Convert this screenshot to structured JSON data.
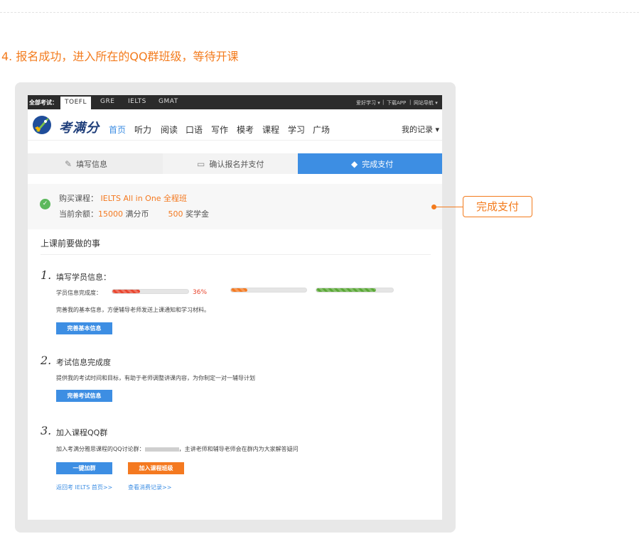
{
  "step_heading": "4. 报名成功，进入所在的QQ群班级，等待开课",
  "exam_bar": {
    "label": "全部考试：",
    "tabs": [
      "TOEFL",
      "GRE",
      "IELTS",
      "GMAT"
    ],
    "active_tab": "TOEFL",
    "right": [
      "爱好学习 ▾",
      "|",
      "下载APP",
      "|",
      "网站导航 ▾"
    ]
  },
  "nav": {
    "brand": "考满分",
    "items": [
      "首页",
      "听力",
      "阅读",
      "口语",
      "写作",
      "模考",
      "课程",
      "学习",
      "广场"
    ],
    "active_item": "首页",
    "my_record": "我的记录 ▾"
  },
  "stepper": {
    "steps": [
      "填写信息",
      "确认报名并支付",
      "完成支付"
    ],
    "current": "完成支付"
  },
  "purchase": {
    "course_label": "购买课程：",
    "course_name": "IELTS All in One 全程班",
    "balance_label": "当前余额：",
    "coins": "15000",
    "coins_unit": "满分币",
    "scholarship": "500",
    "scholarship_unit": "奖学金"
  },
  "todo_title": "上课前要做的事",
  "section1": {
    "num": "1.",
    "title": "填写学员信息：",
    "progress_label": "学员信息完成度：",
    "progress_pct": "36%",
    "bars": [
      {
        "level": 0.36,
        "color": "#e8462f"
      },
      {
        "level": 0.22,
        "color": "#f47920"
      },
      {
        "level": 0.78,
        "color": "#5aa836"
      }
    ],
    "desc": "完善我的基本信息，方便辅导老师发送上课通知和学习材料。",
    "button": "完善基本信息"
  },
  "section2": {
    "num": "2.",
    "title": "考试信息完成度",
    "desc": "提供我的考试时间和目标，有助于老师调整讲课内容，为你制定一对一辅导计划",
    "button": "完善考试信息"
  },
  "section3": {
    "num": "3.",
    "title": "加入课程QQ群",
    "desc_prefix": "加入考满分雅思课程的QQ讨论群：",
    "desc_suffix": "，主讲老师和辅导老师会在群内为大家解答疑问",
    "btn_join": "一键加群",
    "btn_class": "加入课程班级",
    "link_home": "返回考 IELTS 首页>>",
    "link_records": "查看消费记录>>"
  },
  "callout": "完成支付"
}
